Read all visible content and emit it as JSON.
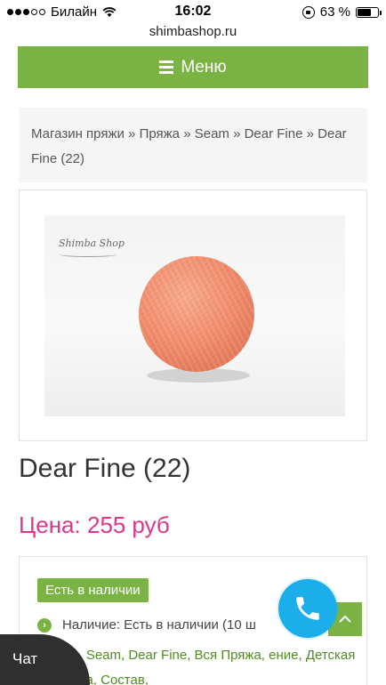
{
  "status_bar": {
    "carrier": "Билайн",
    "time": "16:02",
    "battery_percent": "63 %",
    "battery_level": 0.63,
    "signal_bars": 3
  },
  "browser": {
    "url": "shimbashop.ru"
  },
  "menu": {
    "label": "Меню",
    "icon": "hamburger-icon",
    "color": "#7ab344"
  },
  "breadcrumb": {
    "items": [
      "Магазин пряжи",
      "Пряжа",
      "Seam",
      "Dear Fine",
      "Dear Fine (22)"
    ],
    "separator": "»"
  },
  "product": {
    "image_brand": "Shimba Shop",
    "title": "Dear Fine (22)",
    "price_label": "Цена:",
    "price_value": "255",
    "price_currency": "руб",
    "price_color": "#e0368a"
  },
  "stock": {
    "badge": "Есть в наличии",
    "availability": "Наличие: Есть в наличии (10 ш",
    "tags_text": "яжа, Seam, Dear Fine, Вся Пряжа, ение, Детская пряжа, Состав,"
  },
  "floating": {
    "chat_label": "Чат",
    "call_icon": "phone-icon",
    "scroll_icon": "chevron-up-icon",
    "call_color": "#1baeea"
  }
}
